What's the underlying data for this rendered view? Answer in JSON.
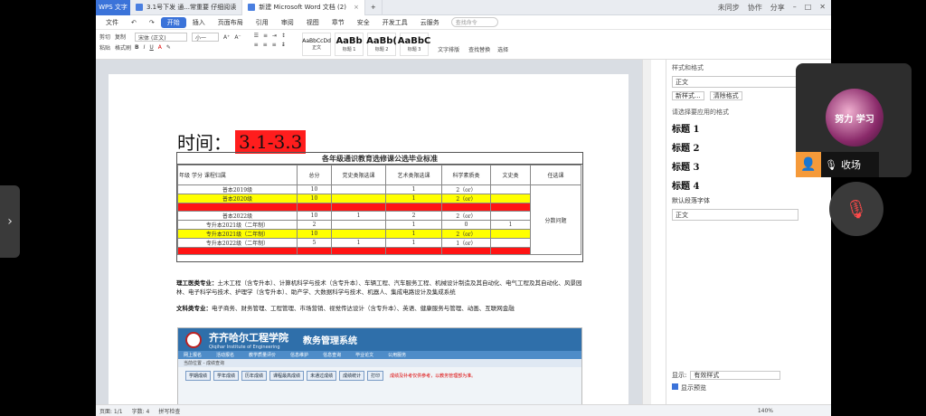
{
  "titlebar": {
    "app": "WPS 文字",
    "tabs": [
      {
        "label": "3.1号下发 通...常重要 仔细阅读"
      },
      {
        "label": "新建 Microsoft Word 文档 (2)"
      }
    ],
    "right": [
      "未同步",
      "协作",
      "分享"
    ]
  },
  "menubar": {
    "items": [
      "文件",
      "开始",
      "插入",
      "页面布局",
      "引用",
      "审阅",
      "视图",
      "章节",
      "安全",
      "开发工具",
      "云服务"
    ],
    "active": "开始",
    "search": "查找命令"
  },
  "ribbon": {
    "clip": [
      "剪切",
      "复制",
      "粘贴",
      "格式刷"
    ],
    "font": "宋体 (正文)",
    "size": "小一",
    "styles": [
      {
        "sample": "AaBbCcDd",
        "name": "正文"
      },
      {
        "sample": "AaBb",
        "name": "标题 1"
      },
      {
        "sample": "AaBb(",
        "name": "标题 2"
      },
      {
        "sample": "AaBbC",
        "name": "标题 3"
      }
    ],
    "tools": [
      "文字排版",
      "查找替换",
      "选择"
    ]
  },
  "doc": {
    "heading": "时间：",
    "heading_red": "3.1-3.3",
    "table_title": "各年级通识教育选修课公选毕业标准",
    "headers": {
      "diag_year": "年级",
      "diag_study": "学分",
      "diag_type": "课程归属",
      "total": "总分",
      "party": "党史类限选课",
      "art": "艺术类限选课",
      "sci": "科学素质类",
      "lit": "文史类",
      "elective": "任选课"
    },
    "rows": [
      {
        "grade": "普本2019级",
        "total": "10",
        "party": "",
        "art": "1",
        "sci": "2（or）",
        "lit": "",
        "hl": ""
      },
      {
        "grade": "普本2020级",
        "total": "10",
        "party": "",
        "art": "1",
        "sci": "2（or）",
        "lit": "",
        "hl": "yel"
      },
      {
        "grade": "",
        "total": "",
        "party": "",
        "art": "",
        "sci": "",
        "lit": "",
        "hl": "red"
      },
      {
        "grade": "普本2022级",
        "total": "10",
        "party": "1",
        "art": "2",
        "sci": "2（or）",
        "lit": "",
        "hl": ""
      },
      {
        "grade": "专升本2021级（二年制）",
        "total": "2",
        "party": "",
        "art": "1",
        "sci": "0",
        "lit": "1",
        "hl": ""
      },
      {
        "grade": "专升本2021级（二年制）",
        "total": "10",
        "party": "",
        "art": "1",
        "sci": "2（or）",
        "lit": "",
        "hl": "yel"
      },
      {
        "grade": "专升本2022级（二年制）",
        "total": "5",
        "party": "1",
        "art": "1",
        "sci": "1（or）",
        "lit": "",
        "hl": ""
      },
      {
        "grade": "",
        "total": "",
        "party": "",
        "art": "",
        "sci": "",
        "lit": "",
        "hl": "red"
      }
    ],
    "elective_note": "分数问题",
    "sci_label": "理工医类专业：",
    "sci_text": "土木工程（含专升本）、计算机科学与技术（含专升本）、车辆工程、汽车服务工程、机械设计制造及其自动化、电气工程及其自动化、风景园林、电子科学与技术、护理学（含专升本）、助产学、大数据科学与技术、机器人、集成电路设计及集成系统",
    "lit_label": "文科类专业：",
    "lit_text": "电子商务、财务管理、工程管理、市场营销、视觉传达设计（含专升本）、英语、健康服务与管理、动画、互联网金融",
    "sys": {
      "name": "齐齐哈尔工程学院",
      "sub": "Qiqihar Institute of Engineering",
      "mgmt": "教务管理系统",
      "nav": [
        "网上报名",
        "活动报名",
        "教学质量评价",
        "信息维护",
        "信息查询",
        "毕业论文",
        "公用服务"
      ],
      "crumb": "当前位置 - 成绩查询",
      "btns": [
        "学期成绩",
        "学年成绩",
        "历年成绩",
        "课程最高成绩",
        "未通过成绩",
        "成绩统计",
        "打印"
      ],
      "warn": "成绩及补考仅供参考，以教务管理部为准。"
    }
  },
  "pane": {
    "title": "样式和格式",
    "current": "正文",
    "new_style": "新样式...",
    "clear": "清除格式",
    "apply_label": "请选择要应用的格式",
    "levels": [
      "标题 1",
      "标题 2",
      "标题 3",
      "标题 4"
    ],
    "default_font": "默认段落字体",
    "body": "正文",
    "show_label": "显示:",
    "show_value": "有效样式",
    "preview": "显示预览"
  },
  "status": {
    "page": "页面: 1/1",
    "words": "字数: 4",
    "spell": "拼写检查",
    "zoom": "140%"
  },
  "meeting": {
    "name": "收场",
    "avatar_text": "努力 学习"
  }
}
